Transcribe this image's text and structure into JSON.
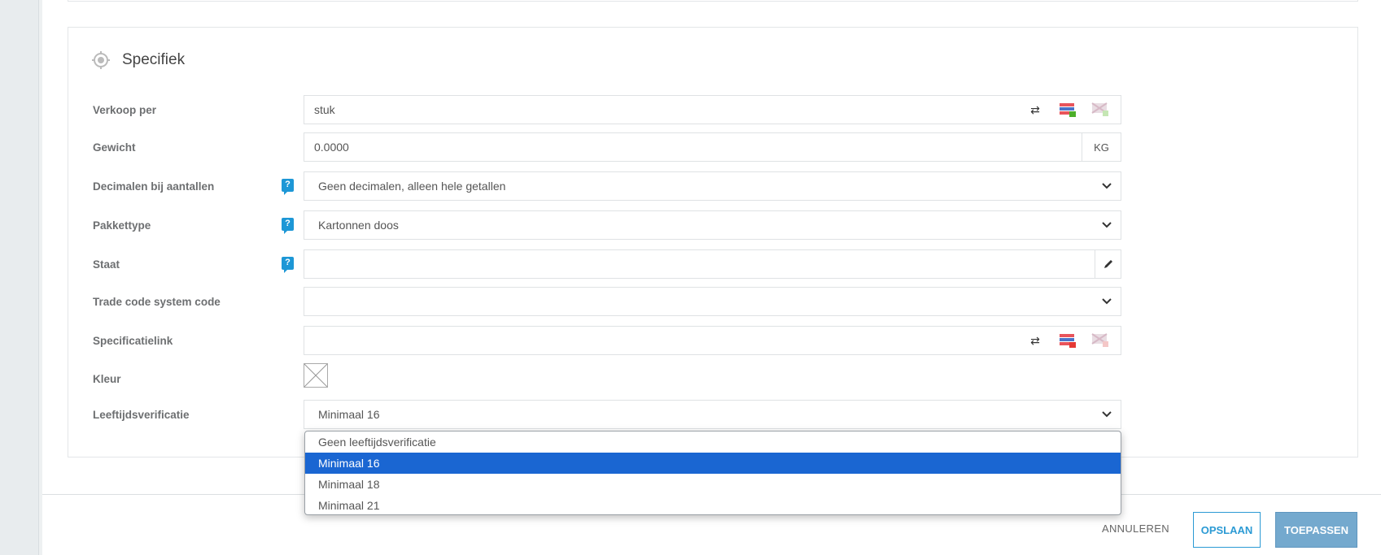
{
  "section": {
    "title": "Specifiek",
    "icon": "target-icon"
  },
  "rows": {
    "verkoop_per": {
      "label": "Verkoop per",
      "value": "stuk"
    },
    "gewicht": {
      "label": "Gewicht",
      "value": "0.0000",
      "unit": "KG"
    },
    "decimalen": {
      "label": "Decimalen bij aantallen",
      "value": "Geen decimalen, alleen hele getallen",
      "help": "?"
    },
    "pakkettype": {
      "label": "Pakkettype",
      "value": "Kartonnen doos",
      "help": "?"
    },
    "staat": {
      "label": "Staat",
      "value": "",
      "help": "?"
    },
    "trade_code": {
      "label": "Trade code system code",
      "value": ""
    },
    "specificatielink": {
      "label": "Specificatielink",
      "value": ""
    },
    "kleur": {
      "label": "Kleur"
    },
    "leeftijd": {
      "label": "Leeftijdsverificatie",
      "value": "Minimaal 16"
    }
  },
  "dropdown": {
    "options": [
      "Geen leeftijdsverificatie",
      "Minimaal 16",
      "Minimaal 18",
      "Minimaal 21"
    ],
    "selected_index": 1
  },
  "footer": {
    "cancel": "ANNULEREN",
    "save": "OPSLAAN",
    "apply": "TOEPASSEN"
  },
  "colors": {
    "accent": "#2b9ad4",
    "selected": "#1a66d2",
    "help": "#1d97d6"
  }
}
